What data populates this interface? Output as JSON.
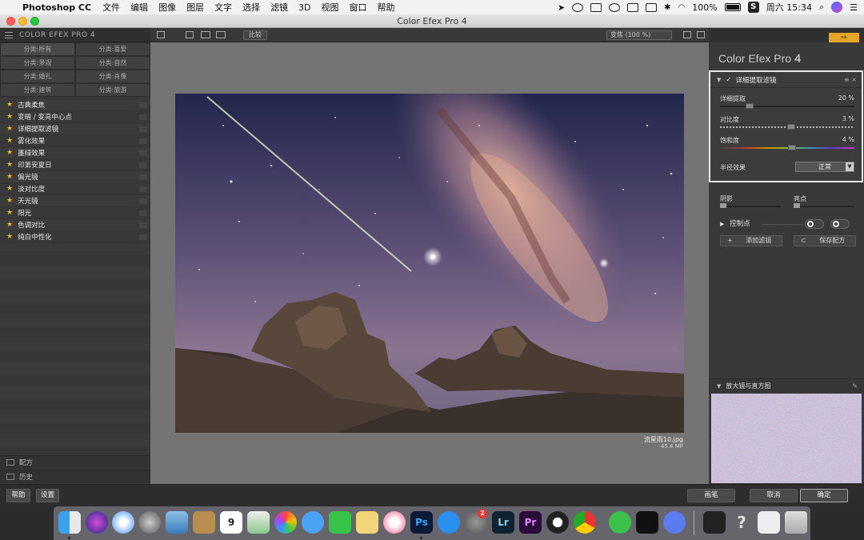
{
  "menubar": {
    "app_name": "Photoshop CC",
    "items": [
      "文件",
      "编辑",
      "图像",
      "图层",
      "文字",
      "选择",
      "滤镜",
      "3D",
      "视图",
      "窗口",
      "帮助"
    ],
    "battery": "100%",
    "clock": "周六 15:34"
  },
  "window": {
    "title": "Color Efex Pro 4"
  },
  "left_panel": {
    "header": "COLOR EFEX PRO 4",
    "categories": [
      "分类:所有",
      "分类:喜爱",
      "分类:景观",
      "分类:自然",
      "分类:婚礼",
      "分类:肖像",
      "分类:建筑",
      "分类:旅游"
    ],
    "filters": [
      "古典柔焦",
      "变暗 / 变亮中心点",
      "详细提取滤镜",
      "雾化效果",
      "墨绿效果",
      "印第安夏日",
      "偏光镜",
      "淡对比度",
      "天光镜",
      "阳光",
      "色调对比",
      "纯白中性化"
    ],
    "recipes_label": "配方",
    "history_label": "历史"
  },
  "center": {
    "compare_label": "比较",
    "zoom_label": "变焦 (100 %)",
    "file_name": "流星雨10.jpg",
    "file_size": "45.4 MP"
  },
  "right_panel": {
    "title_main": "Color Efex Pro",
    "title_version": "4",
    "filter_name": "详细提取滤镜",
    "sliders": [
      {
        "label": "详细提取",
        "value": "20 %",
        "fraction": 0.2,
        "style": "plain"
      },
      {
        "label": "对比度",
        "value": "3 %",
        "fraction": 0.53,
        "style": "dotted"
      },
      {
        "label": "饱和度",
        "value": "4 %",
        "fraction": 0.54,
        "style": "rainbow"
      }
    ],
    "method_label": "半径效果",
    "method_value": "正常",
    "shadows_label": "阴影",
    "highlights_label": "亮点",
    "control_points_label": "控制点",
    "add_filter_label": "添加滤镜",
    "save_recipe_label": "保存配方",
    "loupe_label": "放大镜与直方图"
  },
  "bottom_bar": {
    "help": "帮助",
    "settings": "设置",
    "brush": "画笔",
    "cancel": "取消",
    "ok": "确定"
  },
  "dock": {
    "calendar_day": "9",
    "appstore_badge": "2",
    "ps": "Ps",
    "lr": "Lr",
    "pr": "Pr"
  }
}
